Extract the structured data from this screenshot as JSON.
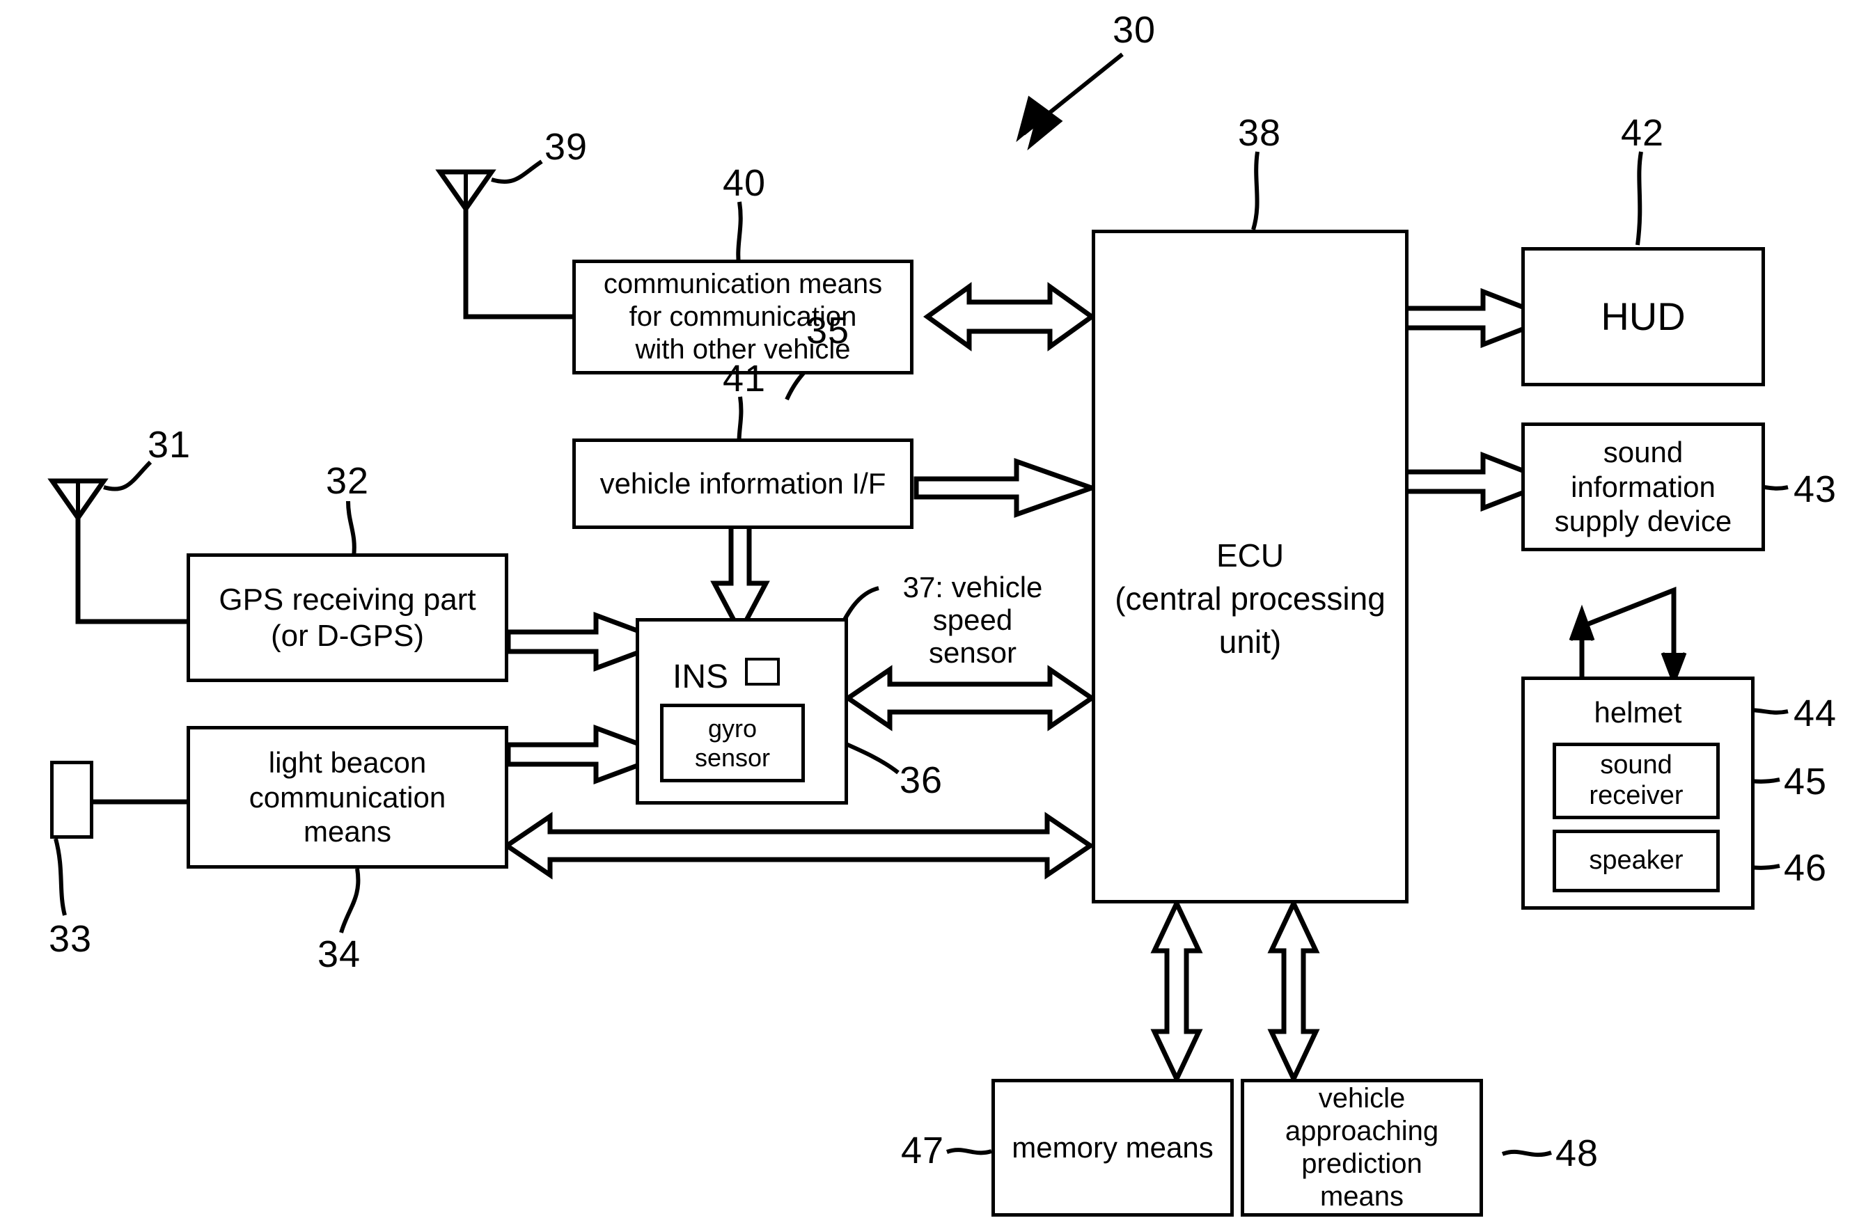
{
  "figure": {
    "system_ref": "30",
    "blocks": {
      "comm_other_vehicle": {
        "label": "communication means\nfor communication\nwith other vehicle",
        "ref": "40"
      },
      "vehicle_info_if": {
        "label": "vehicle information I/F",
        "ref": "41"
      },
      "gps": {
        "label": "GPS receiving part\n(or D-GPS)",
        "ref": "32"
      },
      "light_beacon": {
        "label": "light beacon\ncommunication\nmeans",
        "ref": "34"
      },
      "ins": {
        "label": "INS",
        "ref": "35"
      },
      "gyro": {
        "label": "gyro sensor",
        "ref": "36"
      },
      "ecu": {
        "label": "ECU\n(central processing unit)",
        "ref": "38"
      },
      "hud": {
        "label": "HUD",
        "ref": "42"
      },
      "sound_supply": {
        "label": "sound\ninformation\nsupply device",
        "ref": "43"
      },
      "helmet": {
        "label": "helmet",
        "ref": "44"
      },
      "sound_receiver": {
        "label": "sound\nreceiver",
        "ref": "45"
      },
      "speaker": {
        "label": "speaker",
        "ref": "46"
      },
      "memory": {
        "label": "memory means",
        "ref": "47"
      },
      "prediction": {
        "label": "vehicle\napproaching\nprediction\nmeans",
        "ref": "48"
      }
    },
    "antennas": {
      "gps_antenna": {
        "ref": "31"
      },
      "vehicle_comm_antenna": {
        "ref": "39"
      }
    },
    "sensors": {
      "light_beacon_receiver": {
        "ref": "33"
      },
      "vehicle_speed_sensor": {
        "ref": "37",
        "label": "37: vehicle\nspeed\nsensor"
      }
    },
    "ecu_lines": {
      "line1": "ECU",
      "line2": "(central processing unit)"
    },
    "gps_lines": {
      "line1": "GPS receiving part",
      "line2": "(or D-GPS)"
    },
    "refs": {
      "r30": "30",
      "r31": "31",
      "r32": "32",
      "r33": "33",
      "r34": "34",
      "r35": "35",
      "r36": "36",
      "r38": "38",
      "r39": "39",
      "r40": "40",
      "r41": "41",
      "r42": "42",
      "r43": "43",
      "r44": "44",
      "r45": "45",
      "r46": "46",
      "r47": "47",
      "r48": "48"
    }
  }
}
